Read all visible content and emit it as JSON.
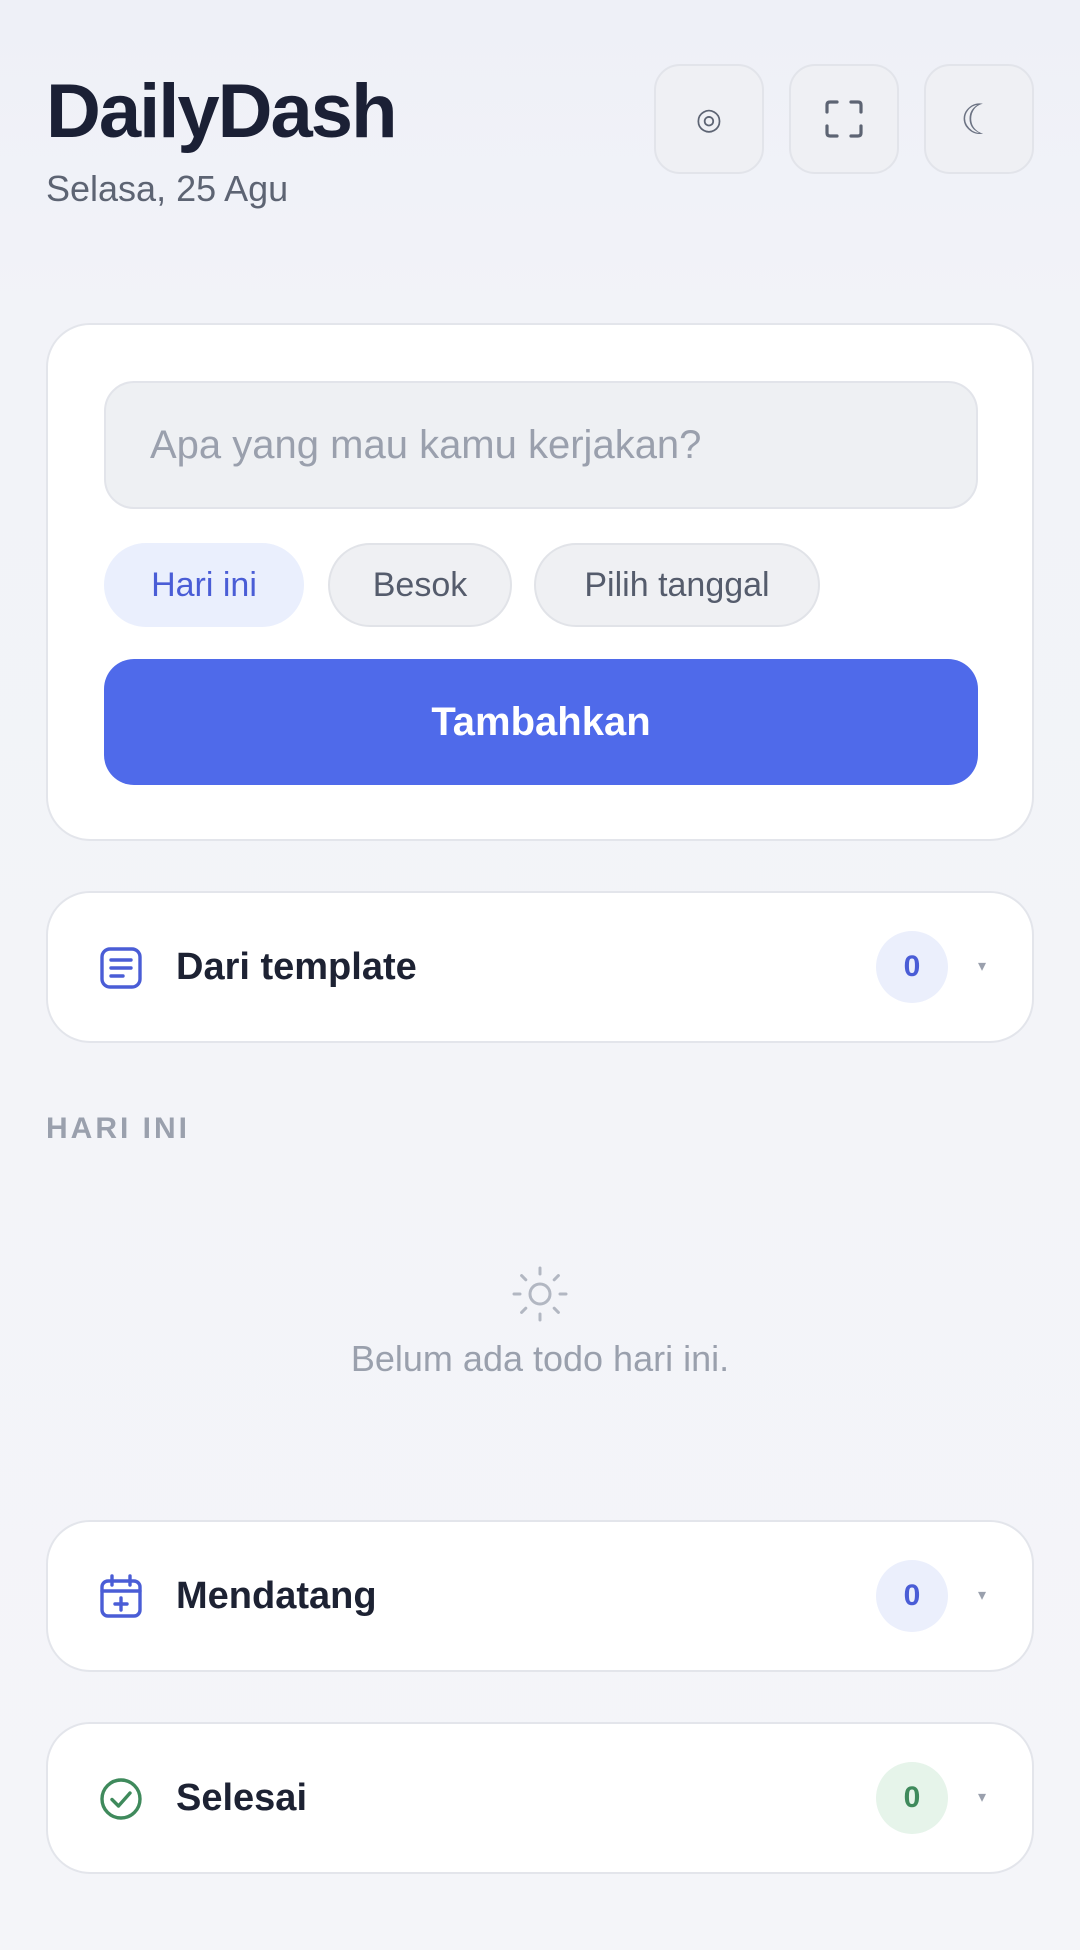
{
  "header": {
    "title": "DailyDash",
    "date": "Selasa, 25 Agu",
    "buttons": [
      {
        "icon": "target-icon",
        "glyph": "◎"
      },
      {
        "icon": "fullscreen-icon"
      },
      {
        "icon": "moon-icon",
        "glyph": "☾"
      }
    ]
  },
  "composer": {
    "input_placeholder": "Apa yang mau kamu kerjakan?",
    "input_value": "",
    "chips": [
      "Hari ini",
      "Besok",
      "Pilih tanggal"
    ],
    "selected_chip": "Hari ini",
    "add_label": "Tambahkan"
  },
  "templates": {
    "label": "Dari template",
    "count": "0",
    "chevron": "▾"
  },
  "today": {
    "section_label": "HARI INI",
    "empty_text": "Belum ada todo hari ini."
  },
  "upcoming": {
    "label": "Mendatang",
    "count": "0",
    "chevron": "▾"
  },
  "done": {
    "label": "Selesai",
    "count": "0",
    "chevron": "▾"
  },
  "colors": {
    "accent": "#4f6aea",
    "accent_soft": "#eaeffd",
    "success": "#3f8a5c",
    "muted": "#9aa0ad",
    "title": "#1b2035"
  }
}
